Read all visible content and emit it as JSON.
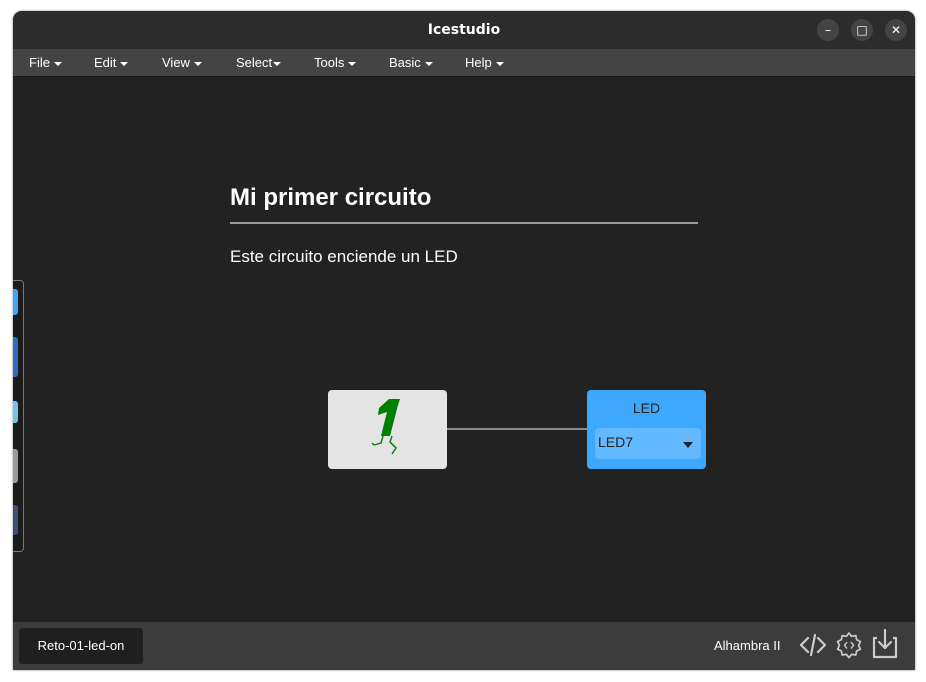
{
  "window": {
    "title": "Icestudio",
    "controls": {
      "minimize": "–",
      "maximize": "□",
      "close": "✕"
    }
  },
  "menu": [
    {
      "label": "File"
    },
    {
      "label": "Edit"
    },
    {
      "label": "View"
    },
    {
      "label": "Select"
    },
    {
      "label": "Tools"
    },
    {
      "label": "Basic"
    },
    {
      "label": "Help"
    }
  ],
  "canvas": {
    "heading": "Mi primer circuito",
    "description": "Este circuito enciende un LED",
    "constant_block": {
      "value": "1",
      "color": "#008000"
    },
    "led_block": {
      "title": "LED",
      "selected": "LED7",
      "color": "#3ea8ff"
    }
  },
  "statusbar": {
    "project": "Reto-01-led-on",
    "board": "Alhambra II",
    "icons": [
      "code-icon",
      "build-gear-icon",
      "upload-icon"
    ]
  }
}
